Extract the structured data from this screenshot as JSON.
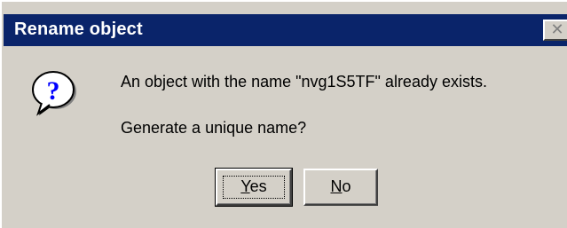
{
  "window": {
    "title": "Rename object",
    "close_glyph": "✕"
  },
  "icon": "question-icon",
  "message": {
    "line1": "An object with the name \"nvg1S5TF\" already exists.",
    "line2": "Generate a unique name?"
  },
  "buttons": {
    "yes": {
      "mnemonic": "Y",
      "rest": "es"
    },
    "no": {
      "mnemonic": "N",
      "rest": "o"
    }
  },
  "colors": {
    "titlebar": "#0a246a",
    "dialog_face": "#d4d0c8",
    "icon_blue": "#0000ff"
  }
}
